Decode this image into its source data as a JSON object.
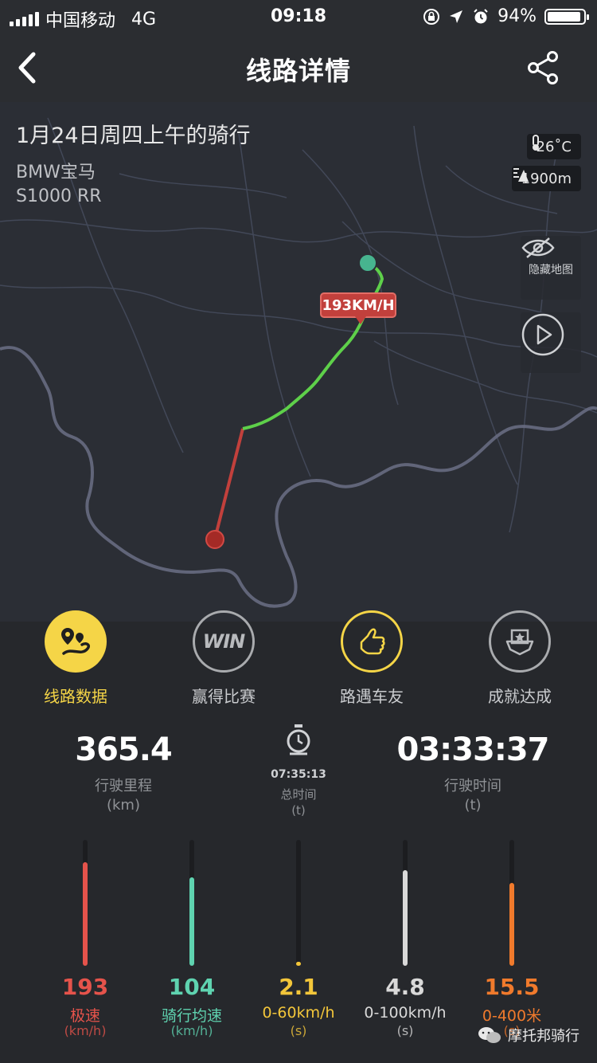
{
  "status_bar": {
    "carrier": "中国移动",
    "network": "4G",
    "time": "09:18",
    "battery": "94%",
    "battery_level": 0.94
  },
  "nav": {
    "title": "线路详情"
  },
  "ride": {
    "title": "1月24日周四上午的骑行",
    "brand": "BMW宝马",
    "model": "S1000 RR",
    "temperature": "26˚C",
    "altitude": "1900m"
  },
  "map": {
    "hide_map_label": "隐藏地图",
    "max_speed_tag": "193KM/H"
  },
  "tabs": [
    {
      "label": "线路数据",
      "active": true
    },
    {
      "label": "赢得比赛",
      "active": false,
      "icon_text": "WIN"
    },
    {
      "label": "路遇车友",
      "active": false
    },
    {
      "label": "成就达成",
      "active": false
    }
  ],
  "summary": {
    "distance": {
      "value": "365.4",
      "label": "行驶里程",
      "unit": "(km)"
    },
    "total_time": {
      "value": "07:35:13",
      "label": "总时间",
      "unit": "(t)"
    },
    "riding_time": {
      "value": "03:33:37",
      "label": "行驶时间",
      "unit": "(t)"
    }
  },
  "bars": [
    {
      "value": "193",
      "label": "极速",
      "unit": "(km/h)",
      "level": 0.82,
      "color": "#e5534b"
    },
    {
      "value": "104",
      "label": "骑行均速",
      "unit": "(km/h)",
      "level": 0.7,
      "color": "#5fd3b0"
    },
    {
      "value": "2.1",
      "label": "0-60km/h",
      "unit": "(s)",
      "level": 0.03,
      "color": "#f3c63a"
    },
    {
      "value": "4.8",
      "label": "0-100km/h",
      "unit": "(s)",
      "level": 0.76,
      "color": "#d9d9d9"
    },
    {
      "value": "15.5",
      "label": "0-400米",
      "unit": "(s)",
      "level": 0.66,
      "color": "#f07a2c"
    }
  ],
  "watermark": {
    "text": "摩托邦骑行"
  },
  "colors": {
    "accent": "#f5d547",
    "route_green": "#5ed04a",
    "route_red": "#c2403c",
    "background": "#26282c"
  }
}
